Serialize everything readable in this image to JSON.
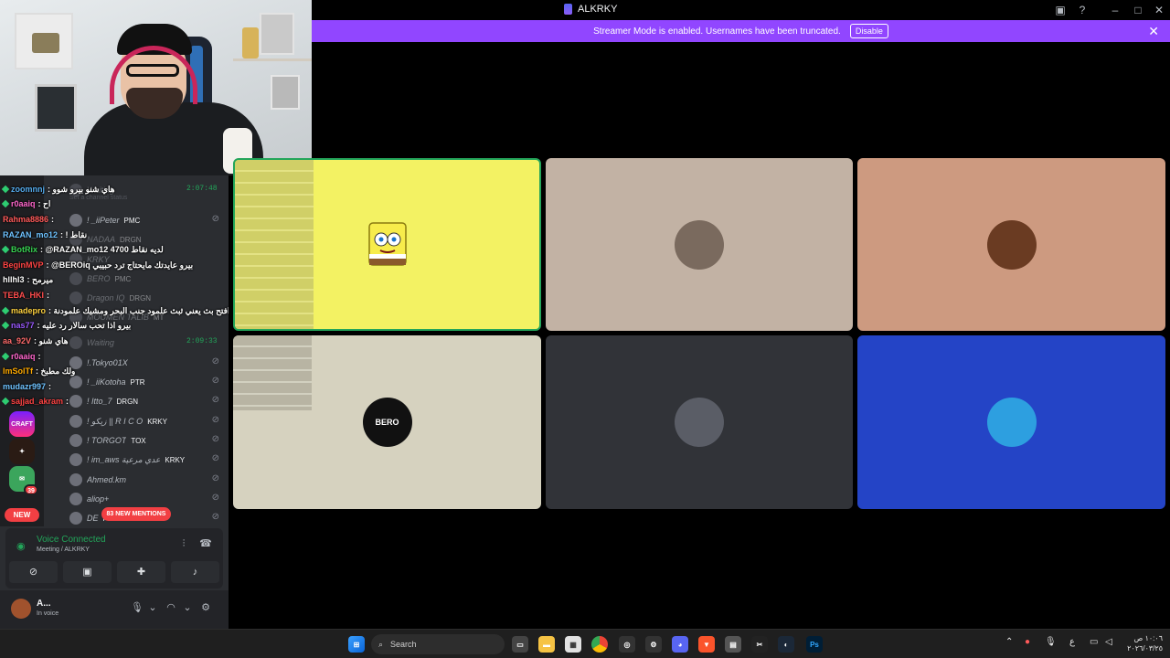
{
  "window": {
    "title": "ALKRKY"
  },
  "banner": {
    "text": "Streamer Mode is enabled. Usernames have been truncated.",
    "button": "Disable"
  },
  "chat": [
    {
      "user": "zoomnnj",
      "text": ": هاي شنو بيرو شوو",
      "color": "#55acee",
      "badge": true
    },
    {
      "user": "r0aaiq",
      "text": ": اح",
      "color": "#ff66cc",
      "badge": true
    },
    {
      "user": "Rahma8886",
      "text": ":",
      "color": "#ff5a5a",
      "badge": false
    },
    {
      "user": "RAZAN_mo12",
      "text": ": ! نقاط",
      "color": "#6ec2ff",
      "badge": false
    },
    {
      "user": "BotRix",
      "text": ": @RAZAN_mo12 لديه نقاط 4700",
      "color": "#39d353",
      "badge": true
    },
    {
      "user": "BeginMVP",
      "text": ": @BEROiq بيرو عايدتك مايحتاج ترد حبيبي",
      "color": "#ff4444",
      "badge": false
    },
    {
      "user": "hllhl3",
      "text": ": ميرمح",
      "color": "#ffffff",
      "badge": false
    },
    {
      "user": "TEBA_HKI",
      "text": ":",
      "color": "#ff4d4d",
      "badge": false
    },
    {
      "user": "madepro",
      "text": ": افتح بث يعني ثبث علمود جنب البحر ومشيك علمودنة",
      "color": "#ffd23f",
      "badge": true
    },
    {
      "user": "nas77",
      "text": ": بيرو اذا تحب سالار رد عليه",
      "color": "#9b59ff",
      "badge": true
    },
    {
      "user": "aa_92V",
      "text": ": هاي شنو",
      "color": "#ff6b6b",
      "badge": false
    },
    {
      "user": "r0aaiq",
      "text": ":",
      "color": "#ff66cc",
      "badge": true
    },
    {
      "user": "ImSolTf",
      "text": ": ولك مطبخ",
      "color": "#ffaa00",
      "badge": false
    },
    {
      "user": "mudazr997",
      "text": ":",
      "color": "#6ec2ff",
      "badge": false
    },
    {
      "user": "sajjad_akram",
      "text": ":",
      "color": "#ff4444",
      "badge": true
    }
  ],
  "members": [
    {
      "name": "Waiting",
      "tag": "",
      "status": "Set a channel status",
      "muted": false,
      "dim": true
    },
    {
      "name": "! _iiPeter",
      "tag": "PMC",
      "muted": true,
      "dim": false
    },
    {
      "name": "NADAA",
      "tag": "DRGN",
      "muted": false,
      "dim": true
    },
    {
      "name": "KRKY",
      "tag": "",
      "muted": false,
      "dim": true
    },
    {
      "name": "BERO",
      "tag": "PMC",
      "muted": false,
      "dim": true
    },
    {
      "name": "Dragon IQ",
      "tag": "DRGN",
      "muted": false,
      "dim": true
    },
    {
      "name": "MOUMEN TALIB",
      "tag": "MT",
      "muted": false,
      "dim": true
    },
    {
      "name": "Waiting",
      "tag": "",
      "muted": false,
      "dim": true
    },
    {
      "name": "!.Tokyo01X",
      "tag": "",
      "muted": true,
      "dim": false
    },
    {
      "name": "! _iiKotoha",
      "tag": "PTR",
      "muted": true,
      "dim": false
    },
    {
      "name": "! Itto_7",
      "tag": "DRGN",
      "muted": true,
      "dim": false
    },
    {
      "name": "! زيكو || R I C O",
      "tag": "KRKY",
      "muted": true,
      "dim": false
    },
    {
      "name": "! TORGOT",
      "tag": "TOX",
      "muted": true,
      "dim": false
    },
    {
      "name": "! im_aws عدي مرعية",
      "tag": "KRKY",
      "muted": true,
      "dim": false
    },
    {
      "name": "Ahmed.km",
      "tag": "",
      "muted": true,
      "dim": false
    },
    {
      "name": "aliop+",
      "tag": "",
      "muted": true,
      "dim": false
    },
    {
      "name": "DE",
      "tag": "PMC",
      "muted": true,
      "dim": false
    }
  ],
  "timestamps": [
    "2:07:48",
    "2:09:33"
  ],
  "guilds": {
    "new_label": "NEW",
    "badge_count": "39"
  },
  "mentions": {
    "label": "83 NEW MENTIONS"
  },
  "voice": {
    "status": "Voice Connected",
    "channel": "Meeting / ALKRKY"
  },
  "user": {
    "name": "A...",
    "status": "In voice"
  },
  "tiles": [
    {
      "label": "",
      "bg": "#f3f263",
      "avatar_color": "#f3f263",
      "speaking": true
    },
    {
      "label": "",
      "bg": "#c2b2a4",
      "avatar_color": "#7a6a5e",
      "speaking": false
    },
    {
      "label": "",
      "bg": "#cd9a80",
      "avatar_color": "#6a3b22",
      "speaking": false
    },
    {
      "label": "BERO",
      "bg": "#d6d2bf",
      "avatar_color": "#111111",
      "speaking": false
    },
    {
      "label": "",
      "bg": "#313338",
      "avatar_color": "#5a5d66",
      "speaking": false
    },
    {
      "label": "",
      "bg": "#2444c6",
      "avatar_color": "#2d9fe0",
      "speaking": false
    }
  ],
  "taskbar": {
    "search": "Search",
    "clock_time": "١٠:٠٦ ص",
    "clock_date": "٢٠٢٦/٠٣/٢٥",
    "lang": "ع"
  }
}
